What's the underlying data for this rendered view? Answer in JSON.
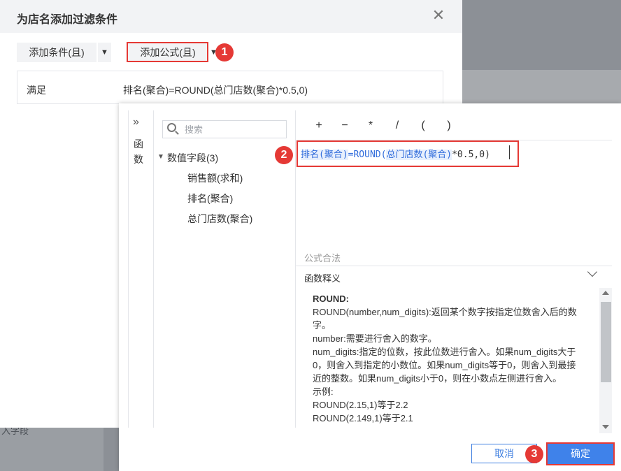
{
  "filter_dialog": {
    "title": "为店名添加过滤条件",
    "close_icon": "close-icon",
    "add_condition_label": "添加条件(且)",
    "add_formula_label": "添加公式(且)",
    "condition": {
      "label": "满足",
      "expression": "排名(聚合)=ROUND(总门店数(聚合)*0.5,0)"
    }
  },
  "background": {
    "partial_text": "入字段"
  },
  "formula_dialog": {
    "side_tab": {
      "expand_icon": "double-chevron-right-icon",
      "label": "函数"
    },
    "search": {
      "placeholder": "搜索"
    },
    "field_tree": {
      "root_label": "数值字段(3)",
      "items": [
        "销售额(求和)",
        "排名(聚合)",
        "总门店数(聚合)"
      ]
    },
    "operators": [
      "+",
      "−",
      "*",
      "/",
      "(",
      ")"
    ],
    "formula_tokens": {
      "field1": "排名(聚合)",
      "eq_func": "=ROUND(",
      "field2": "总门店数(聚合)",
      "tail": "*0.5,0)"
    },
    "validation": "公式合法",
    "explain": {
      "title": "函数释义",
      "func_name": "ROUND:",
      "lines": [
        "ROUND(number,num_digits):返回某个数字按指定位数舍入后的数字。",
        "number:需要进行舍入的数字。",
        "num_digits:指定的位数，按此位数进行舍入。如果num_digits大于0，则舍入到指定的小数位。如果num_digits等于0，则舍入到最接近的整数。如果num_digits小于0，则在小数点左侧进行舍入。",
        "示例:",
        "ROUND(2.15,1)等于2.2",
        "ROUND(2.149,1)等于2.1"
      ]
    },
    "cancel_label": "取消",
    "ok_label": "确定"
  },
  "annotations": {
    "badge1": "1",
    "badge2": "2",
    "badge3": "3",
    "highlight_color": "#e53935"
  },
  "colors": {
    "primary": "#3f82ea",
    "field_token": "#2f6bdb"
  }
}
